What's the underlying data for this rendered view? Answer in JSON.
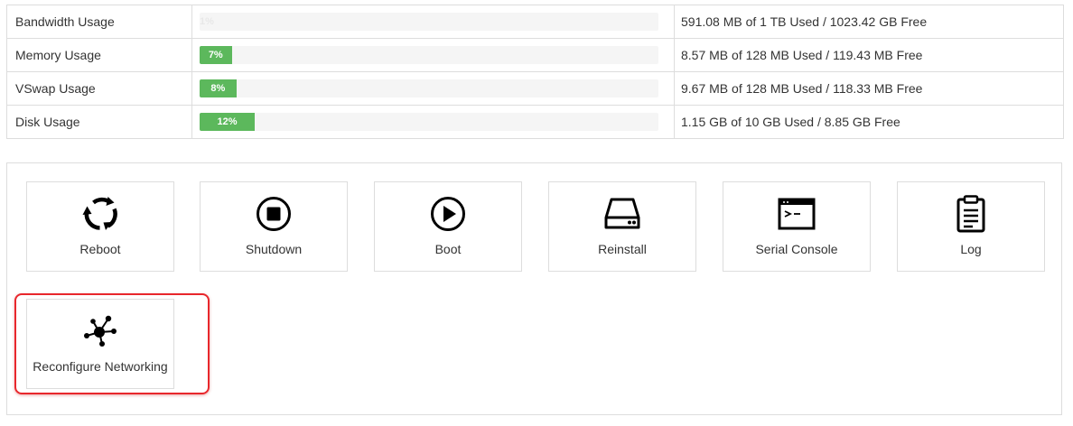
{
  "usage": {
    "rows": [
      {
        "label": "Bandwidth Usage",
        "percent": 1,
        "percent_label": "1%",
        "detail": "591.08 MB of 1 TB Used / 1023.42 GB Free"
      },
      {
        "label": "Memory Usage",
        "percent": 7,
        "percent_label": "7%",
        "detail": "8.57 MB of 128 MB Used / 119.43 MB Free"
      },
      {
        "label": "VSwap Usage",
        "percent": 8,
        "percent_label": "8%",
        "detail": "9.67 MB of 128 MB Used / 118.33 MB Free"
      },
      {
        "label": "Disk Usage",
        "percent": 12,
        "percent_label": "12%",
        "detail": "1.15 GB of 10 GB Used / 8.85 GB Free"
      }
    ],
    "bar_color": "#5cb85c"
  },
  "controls": {
    "buttons": [
      {
        "label": "Reboot",
        "icon": "reboot-icon"
      },
      {
        "label": "Shutdown",
        "icon": "stop-circle-icon"
      },
      {
        "label": "Boot",
        "icon": "play-circle-icon"
      },
      {
        "label": "Reinstall",
        "icon": "hard-drive-icon"
      },
      {
        "label": "Serial Console",
        "icon": "terminal-icon"
      },
      {
        "label": "Log",
        "icon": "clipboard-icon"
      },
      {
        "label": "Reconfigure Networking",
        "icon": "network-hub-icon"
      }
    ],
    "highlight_color": "#e8272c"
  }
}
